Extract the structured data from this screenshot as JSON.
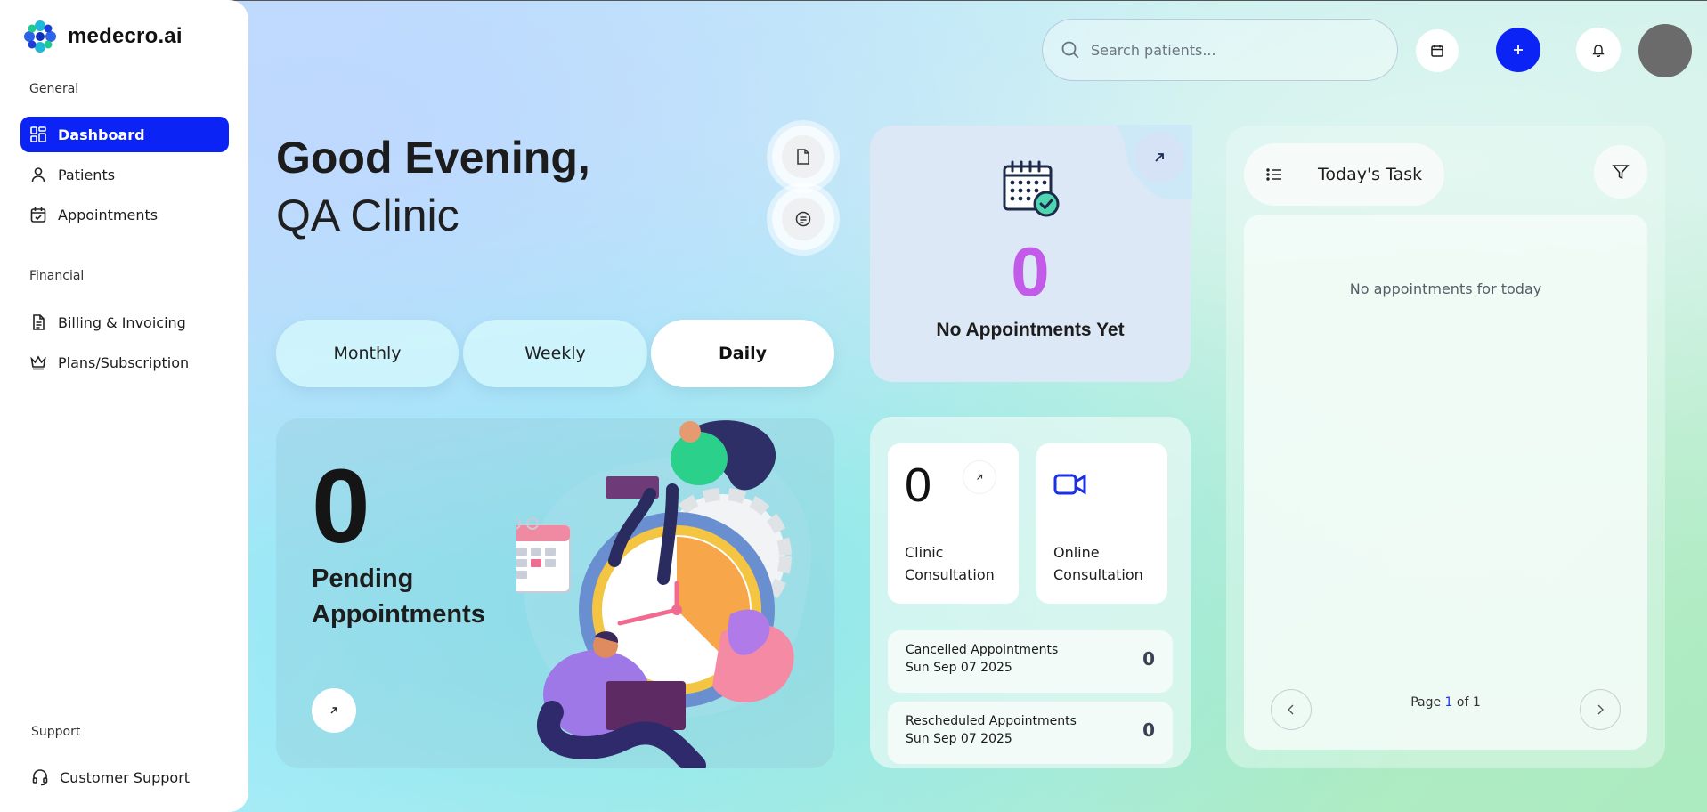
{
  "app": {
    "name": "medecro.ai"
  },
  "sidebar": {
    "sections": [
      {
        "label": "General"
      },
      {
        "label": "Financial"
      },
      {
        "label": "Support"
      }
    ],
    "items": [
      {
        "label": "Dashboard",
        "icon": "dashboard-icon",
        "active": true
      },
      {
        "label": "Patients",
        "icon": "user-icon"
      },
      {
        "label": "Appointments",
        "icon": "calendar-check-icon"
      },
      {
        "label": "Billing & Invoicing",
        "icon": "document-icon"
      },
      {
        "label": "Plans/Subscription",
        "icon": "crown-icon"
      },
      {
        "label": "Customer Support",
        "icon": "headset-icon"
      }
    ]
  },
  "topbar": {
    "search_placeholder": "Search patients...",
    "accent": "#0b24f5"
  },
  "greeting": {
    "line1": "Good Evening,",
    "line2": "QA Clinic"
  },
  "period_tabs": [
    {
      "label": "Monthly"
    },
    {
      "label": "Weekly"
    },
    {
      "label": "Daily",
      "active": true
    }
  ],
  "pending": {
    "count": "0",
    "label": "Pending Appointments"
  },
  "appointments_summary": {
    "count": "0",
    "label": "No Appointments Yet",
    "count_color": "#c25be8"
  },
  "consultations": {
    "clinic": {
      "count": "0",
      "label": "Clinic Consultation"
    },
    "online": {
      "label": "Online Consultation"
    }
  },
  "stats": [
    {
      "title": "Cancelled Appointments",
      "date": "Sun Sep 07 2025",
      "value": "0"
    },
    {
      "title": "Rescheduled Appointments",
      "date": "Sun Sep 07 2025",
      "value": "0"
    }
  ],
  "tasks": {
    "title": "Today's Task",
    "empty_text": "No appointments for today",
    "pager": {
      "prefix": "Page",
      "current": "1",
      "sep": "of",
      "total": "1"
    }
  }
}
